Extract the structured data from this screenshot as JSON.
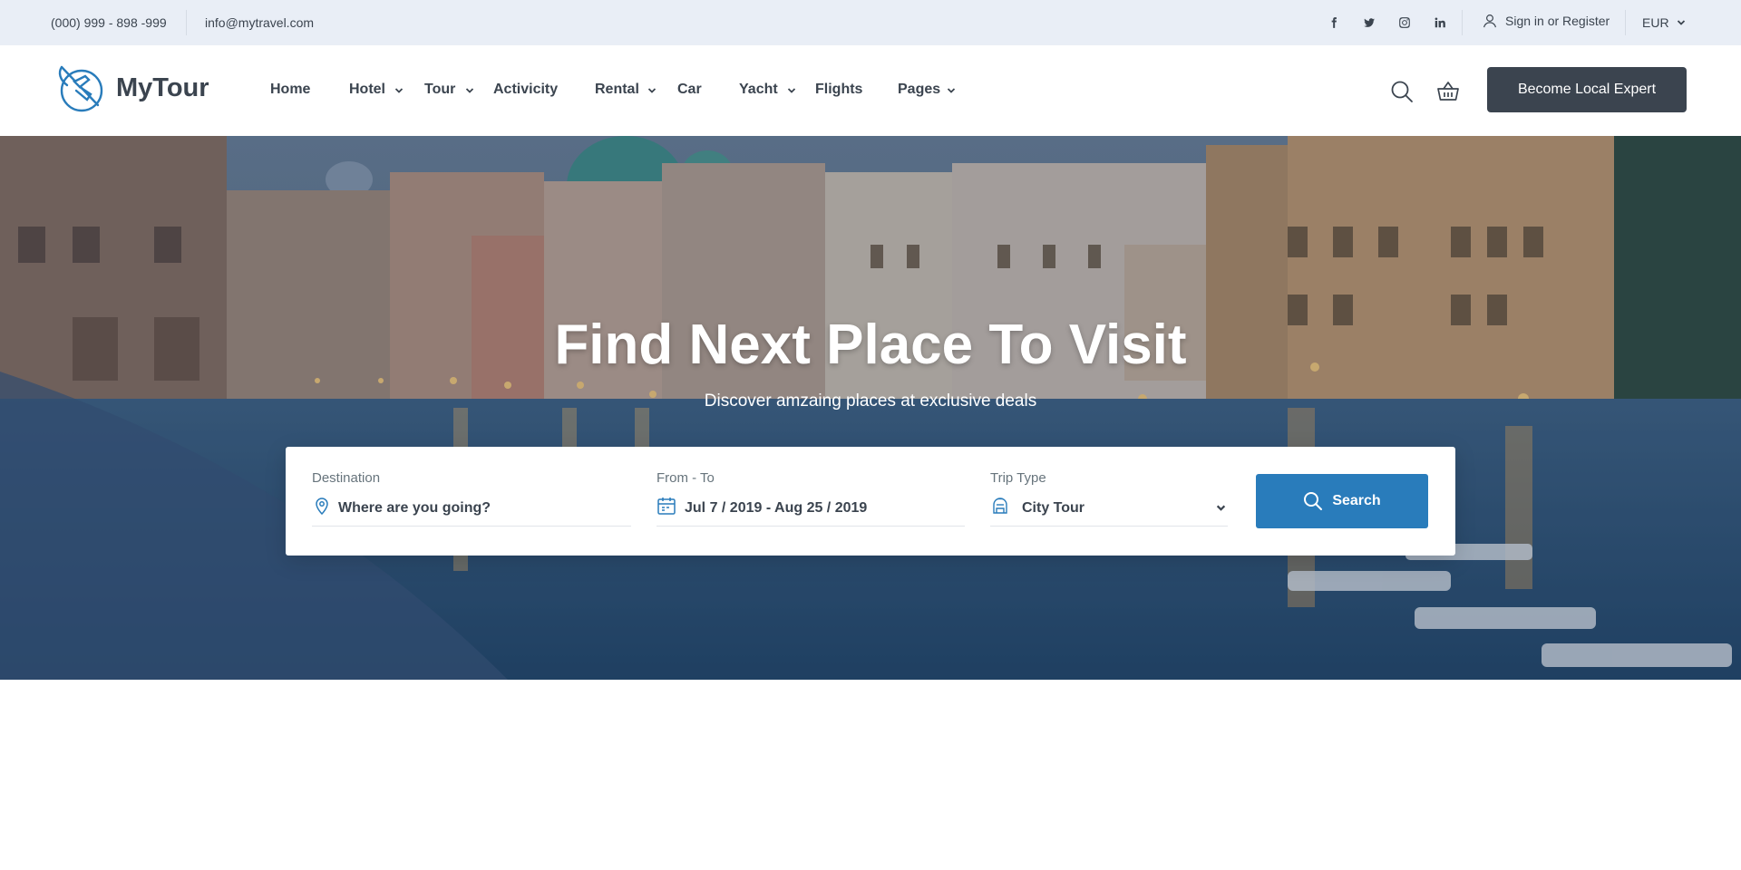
{
  "topbar": {
    "phone": "(000) 999 - 898 -999",
    "email": "info@mytravel.com",
    "social": [
      {
        "icon": "facebook-icon"
      },
      {
        "icon": "twitter-icon"
      },
      {
        "icon": "instagram-icon"
      },
      {
        "icon": "linkedin-icon"
      }
    ],
    "signin_label": "Sign in or Register",
    "currency": "EUR"
  },
  "header": {
    "brand": "MyTour",
    "nav": [
      {
        "label": "Home",
        "dropdown": false
      },
      {
        "label": "Hotel",
        "dropdown": true
      },
      {
        "label": "Tour",
        "dropdown": true
      },
      {
        "label": "Activicity",
        "dropdown": false
      },
      {
        "label": "Rental",
        "dropdown": true
      },
      {
        "label": "Car",
        "dropdown": false
      },
      {
        "label": "Yacht",
        "dropdown": true
      },
      {
        "label": "Flights",
        "dropdown": false
      },
      {
        "label": "Pages",
        "dropdown": true
      }
    ],
    "cta_label": "Become Local Expert"
  },
  "hero": {
    "title": "Find Next Place To Visit",
    "subtitle": "Discover amzaing places at exclusive deals"
  },
  "search": {
    "destination": {
      "label": "Destination",
      "value": "Where are you going?"
    },
    "dates": {
      "label": "From - To",
      "value": "Jul 7 / 2019 - Aug 25 / 2019"
    },
    "trip_type": {
      "label": "Trip Type",
      "value": "City Tour"
    },
    "button_label": "Search"
  },
  "colors": {
    "primary": "#297cbb",
    "dark": "#3b444f",
    "topbar_bg": "#e9eef6"
  }
}
